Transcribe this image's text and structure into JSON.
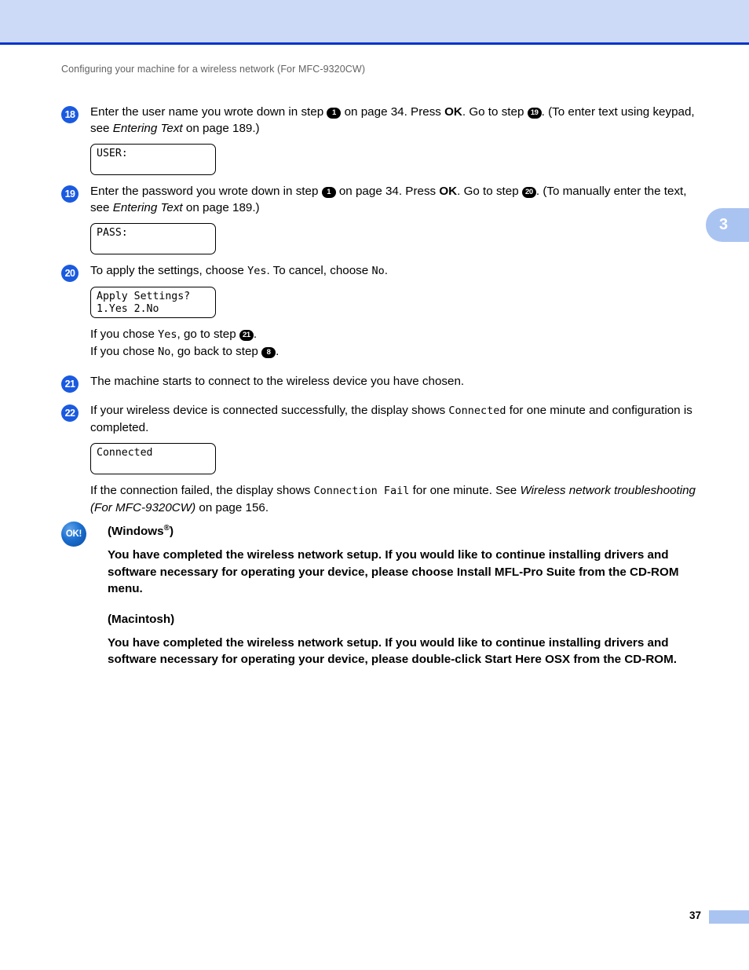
{
  "theme": {
    "banner_bg": "#ccd9f7",
    "banner_border": "#0033cc",
    "tab_bg": "#aac4f2",
    "step_marker_bg": "#1a5ae0",
    "header_text": "#636363"
  },
  "header": {
    "running_title": "Configuring your machine for a wireless network (For MFC-9320CW)"
  },
  "chapter_tab": {
    "number": "3"
  },
  "steps": [
    {
      "marker": "18",
      "text_parts": {
        "a": "Enter the user name you wrote down in step ",
        "ref1": "1",
        "b": " on page 34. Press ",
        "ok": "OK",
        "c": ". Go to step ",
        "ref2": "19",
        "d": ". (To enter text using keypad, see ",
        "italic": "Entering Text",
        "e": " on page 189.)"
      },
      "lcd": {
        "lines": [
          "USER:"
        ]
      }
    },
    {
      "marker": "19",
      "text_parts": {
        "a": "Enter the password you wrote down in step ",
        "ref1": "1",
        "b": " on page 34. Press ",
        "ok": "OK",
        "c": ". Go to step ",
        "ref2": "20",
        "d": ". (To manually enter the text, see ",
        "italic": "Entering Text",
        "e": " on page 189.)"
      },
      "lcd": {
        "lines": [
          "PASS:"
        ]
      }
    },
    {
      "marker": "20",
      "text_parts": {
        "a": "To apply the settings, choose ",
        "mono1": "Yes",
        "b": ". To cancel, choose ",
        "mono2": "No",
        "c": "."
      },
      "lcd": {
        "lines": [
          "Apply Settings?",
          "1.Yes 2.No"
        ]
      },
      "notes": {
        "line1_a": "If you chose ",
        "line1_mono": "Yes",
        "line1_b": ", go to step ",
        "line1_ref": "21",
        "line1_c": ".",
        "line2_a": "If you chose ",
        "line2_mono": "No",
        "line2_b": ", go back to step ",
        "line2_ref": "8",
        "line2_c": "."
      }
    },
    {
      "marker": "21",
      "text_parts": {
        "a": "The machine starts to connect to the wireless device you have chosen."
      }
    },
    {
      "marker": "22",
      "text_parts": {
        "a": "If your wireless device is connected successfully, the display shows ",
        "mono1": "Connected",
        "b": " for one minute and configuration is completed."
      },
      "lcd": {
        "lines": [
          "Connected"
        ]
      },
      "fail_note": {
        "a": "If the connection failed, the display shows ",
        "mono": "Connection Fail",
        "b": " for one minute. See ",
        "italic": "Wireless network troubleshooting (For MFC-9320CW)",
        "c": " on page 156."
      }
    }
  ],
  "ok_callout": {
    "badge_label": "OK!",
    "windows_heading_pre": "(Windows",
    "windows_heading_sup": "®",
    "windows_heading_post": ")",
    "windows_paragraph": "You have completed the wireless network setup. If you would like to continue installing drivers and software necessary for operating your device, please choose Install MFL-Pro Suite from the CD-ROM menu.",
    "macintosh_heading": "(Macintosh)",
    "macintosh_paragraph": "You have completed the wireless network setup. If you would like to continue installing drivers and software necessary for operating your device, please double-click Start Here OSX from the CD-ROM."
  },
  "footer": {
    "page_number": "37"
  }
}
